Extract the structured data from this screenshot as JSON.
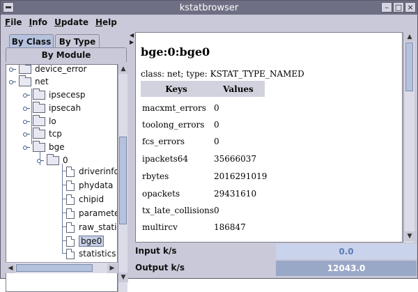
{
  "window": {
    "title": "kstatbrowser",
    "controls": {
      "minimize": "–",
      "maximize": "□",
      "close": "×"
    }
  },
  "menu": [
    {
      "first": "F",
      "rest": "ile"
    },
    {
      "first": "I",
      "rest": "nfo"
    },
    {
      "first": "U",
      "rest": "pdate"
    },
    {
      "first": "H",
      "rest": "elp"
    }
  ],
  "tabs": {
    "by_class": "By Class",
    "by_type": "By Type",
    "by_module": "By Module"
  },
  "tree": [
    {
      "label": "device_error",
      "type": "folder",
      "level": 0
    },
    {
      "label": "net",
      "type": "folder",
      "level": 0
    },
    {
      "label": "ipsecesp",
      "type": "folder",
      "level": 1
    },
    {
      "label": "ipsecah",
      "type": "folder",
      "level": 1
    },
    {
      "label": "lo",
      "type": "folder",
      "level": 1
    },
    {
      "label": "tcp",
      "type": "folder",
      "level": 1
    },
    {
      "label": "bge",
      "type": "folder",
      "level": 1
    },
    {
      "label": "0",
      "type": "folder",
      "level": 2
    },
    {
      "label": "driverinfo",
      "type": "leaf",
      "level": 3
    },
    {
      "label": "phydata",
      "type": "leaf",
      "level": 3
    },
    {
      "label": "chipid",
      "type": "leaf",
      "level": 3
    },
    {
      "label": "parameters",
      "type": "leaf",
      "level": 3
    },
    {
      "label": "raw_statistics",
      "type": "leaf",
      "level": 3
    },
    {
      "label": "bge0",
      "type": "leaf",
      "level": 3,
      "selected": true
    },
    {
      "label": "statistics",
      "type": "leaf",
      "level": 3
    }
  ],
  "detail": {
    "title": "bge:0:bge0",
    "class_line": "class: net; type: KSTAT_TYPE_NAMED",
    "headers": {
      "keys": "Keys",
      "values": "Values"
    },
    "rows": [
      {
        "key": "macxmt_errors",
        "value": "0"
      },
      {
        "key": "toolong_errors",
        "value": "0"
      },
      {
        "key": "fcs_errors",
        "value": "0"
      },
      {
        "key": "ipackets64",
        "value": "35666037"
      },
      {
        "key": "rbytes",
        "value": "2016291019"
      },
      {
        "key": "opackets",
        "value": "29431610"
      },
      {
        "key": "tx_late_collisions",
        "value": "0"
      },
      {
        "key": "multircv",
        "value": "186847"
      }
    ]
  },
  "status": {
    "input_label": "Input k/s",
    "input_value": "0.0",
    "output_label": "Output k/s",
    "output_value": "12043.0"
  },
  "colors": {
    "input_field": "#c9d3ec",
    "output_field": "#9aa8c8",
    "selected_tab": "#b4c2de"
  }
}
